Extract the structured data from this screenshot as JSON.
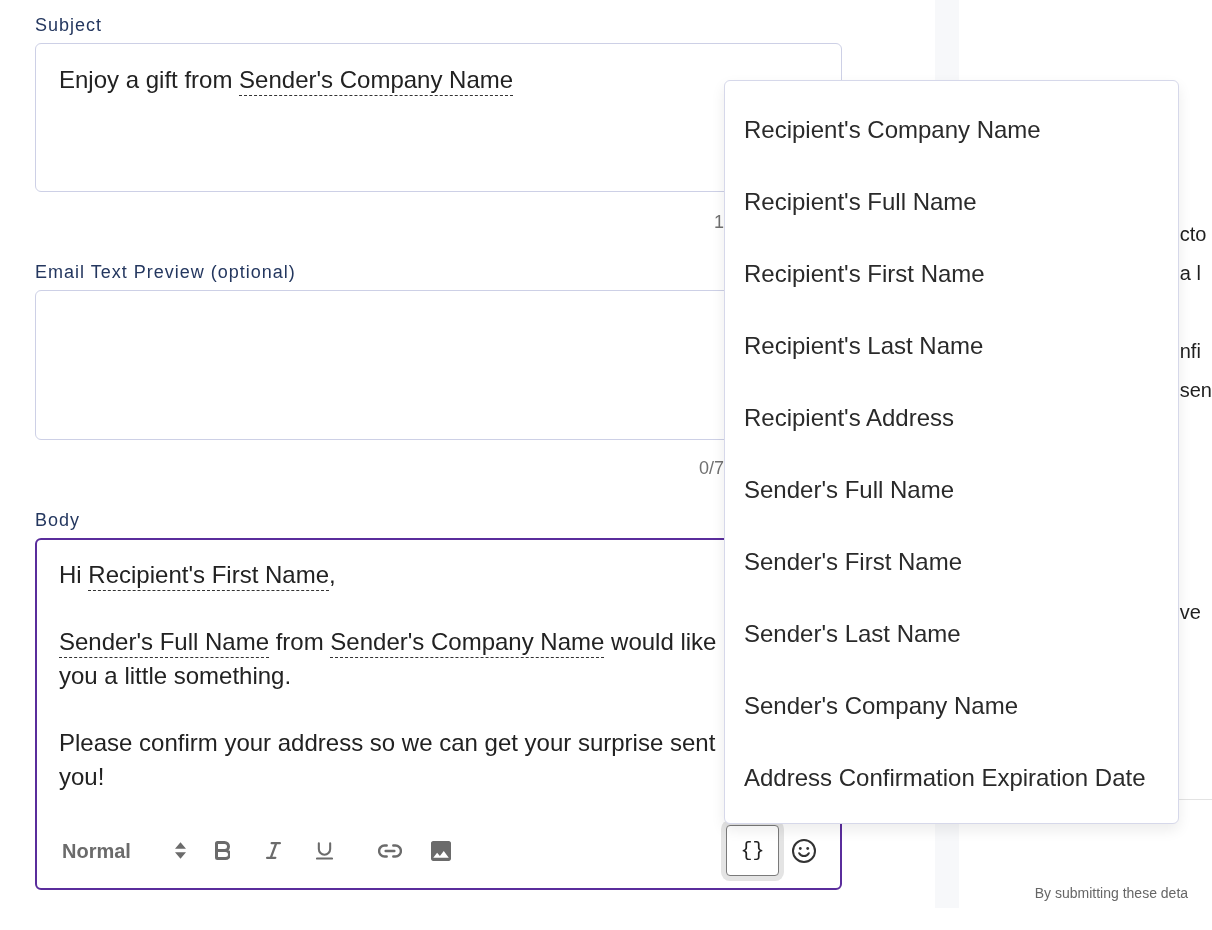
{
  "form": {
    "subject": {
      "label": "Subject",
      "value": [
        {
          "kind": "text",
          "text": "Enjoy a gift from "
        },
        {
          "kind": "token",
          "text": "Sender's Company Name"
        }
      ],
      "counter": "1"
    },
    "preview": {
      "label": "Email Text Preview (optional)",
      "counter": "0/7"
    },
    "body": {
      "label": "Body",
      "focused": true,
      "paragraphs": [
        {
          "lines": [
            [
              {
                "kind": "text",
                "text": "Hi "
              },
              {
                "kind": "token",
                "text": "Recipient's First Name"
              },
              {
                "kind": "text",
                "text": ","
              }
            ]
          ]
        },
        {
          "lines": [
            [
              {
                "kind": "token",
                "text": "Sender's Full Name"
              },
              {
                "kind": "text",
                "text": " from "
              },
              {
                "kind": "token",
                "text": "Sender's Company Name"
              },
              {
                "kind": "text",
                "text": " would like"
              }
            ],
            [
              {
                "kind": "text",
                "text": "you a little something."
              }
            ]
          ]
        },
        {
          "lines": [
            [
              {
                "kind": "text",
                "text": "Please confirm your address so we can get your surprise sent"
              }
            ],
            [
              {
                "kind": "text",
                "text": "you!"
              }
            ]
          ]
        }
      ],
      "toolbar": {
        "format_select": {
          "value": "Normal"
        },
        "button_groups": [
          [
            {
              "kind": "bold"
            },
            {
              "kind": "italic"
            },
            {
              "kind": "underline"
            }
          ],
          [
            {
              "kind": "link"
            },
            {
              "kind": "image"
            }
          ]
        ],
        "variables_button": {
          "label": "{}",
          "expanded": true
        },
        "end_buttons": [
          {
            "kind": "emoji"
          }
        ]
      }
    }
  },
  "variables_menu": {
    "items": [
      "Recipient's Company Name",
      "Recipient's Full Name",
      "Recipient's First Name",
      "Recipient's Last Name",
      "Recipient's Address",
      "Sender's Full Name",
      "Sender's First Name",
      "Sender's Last Name",
      "Sender's Company Name",
      "Address Confirmation Expiration Date"
    ]
  },
  "side_panel": {
    "texts": [
      "cto",
      "a l",
      "nfi",
      "sen",
      "ve"
    ],
    "footer": "By submitting these deta"
  }
}
